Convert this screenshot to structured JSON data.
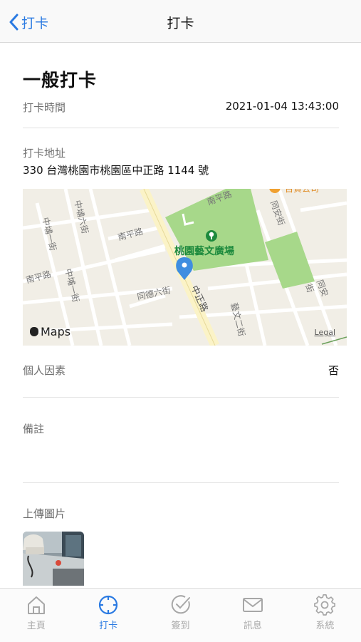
{
  "nav": {
    "back_label": "打卡",
    "title": "打卡"
  },
  "record": {
    "heading": "一般打卡",
    "time_label": "打卡時間",
    "time_value": "2021-01-04 13:43:00",
    "address_label": "打卡地址",
    "address_value": "330 台灣桃園市桃園區中正路 1144 號",
    "personal_factor_label": "個人因素",
    "personal_factor_value": "否",
    "note_label": "備註",
    "note_value": "",
    "upload_label": "上傳圖片"
  },
  "map": {
    "park_name": "桃園藝文廣場",
    "logo_text": "Maps",
    "legal_text": "Legal",
    "road_labels": [
      "中埔六街",
      "南平路",
      "中埔一街",
      "中埔一街",
      "南平路",
      "同德六街",
      "中正路",
      "藝文二街",
      "同安街",
      "同安街",
      "南平路"
    ]
  },
  "tabbar": {
    "items": [
      {
        "label": "主頁",
        "icon": "home-icon"
      },
      {
        "label": "打卡",
        "icon": "crosshair-icon"
      },
      {
        "label": "簽到",
        "icon": "check-circle-icon"
      },
      {
        "label": "訊息",
        "icon": "envelope-icon"
      },
      {
        "label": "系統",
        "icon": "gear-icon"
      }
    ],
    "active_index": 1
  },
  "colors": {
    "accent": "#2a7ae2",
    "park": "#a7d88a",
    "label_gray": "#6f6f6f",
    "tab_inactive": "#a7a7a7"
  }
}
